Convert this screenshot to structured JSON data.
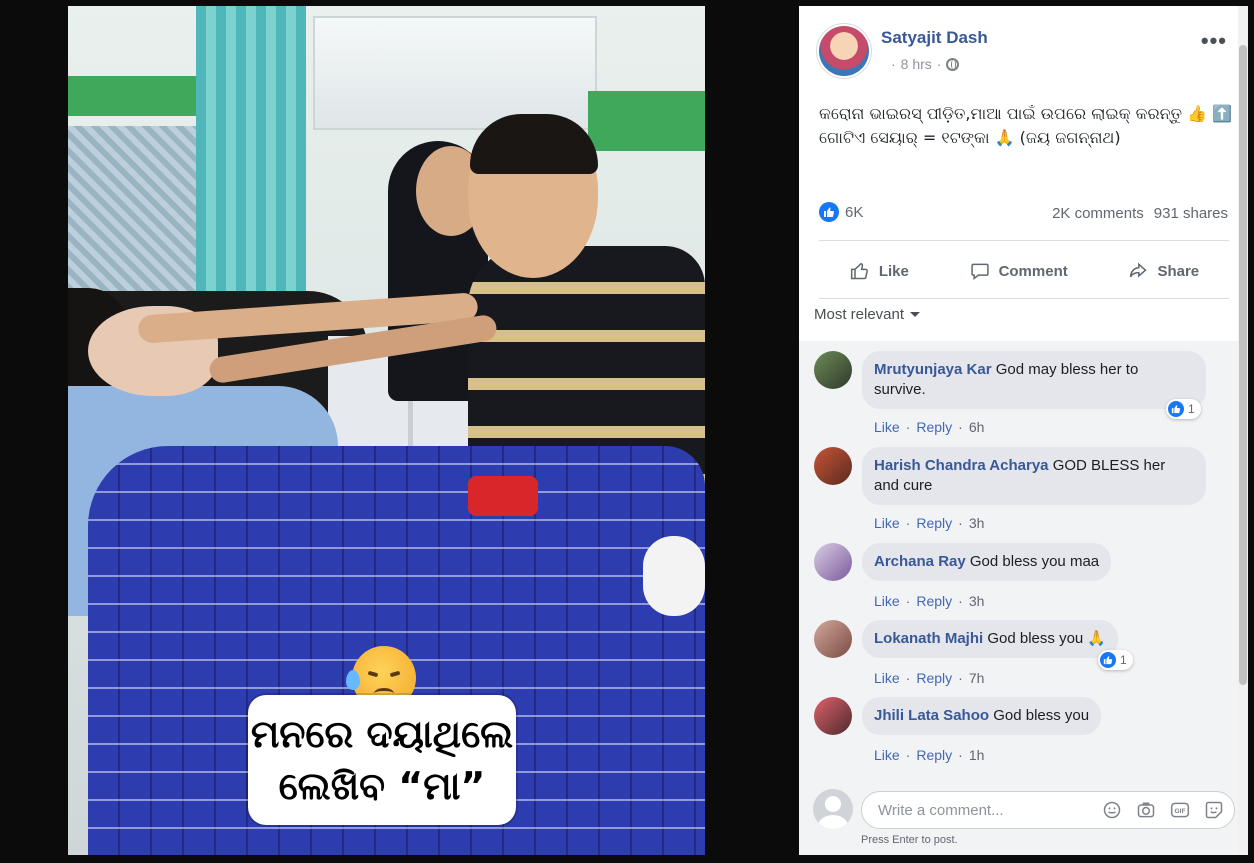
{
  "post": {
    "author": "Satyajit Dash",
    "time": "8 hrs",
    "dots": "·",
    "more": "•••",
    "text_line1": "କରୋନା ଭାଇରସ୍ ପୀଡ଼ିତ,ମାଆ ପାଇଁ ଉପରେ ଲାଇକ୍ କରନ୍ତୁ 👍 ⬆️",
    "text_line2": "ଗୋଟିଏ ସେୟାର୍ = ୧ଟଙ୍କା 🙏 (ଜୟ ଜଗନ୍ନାଥ)",
    "reaction_count": "6K",
    "comments_count": "2K comments",
    "shares_count": "931 shares"
  },
  "photo_caption": {
    "line1": "ମନରେ ଦୟାଥିଲେ",
    "line2": "ଲେଖିବ “ମା”"
  },
  "actions": {
    "like": "Like",
    "comment": "Comment",
    "share": "Share"
  },
  "sort": {
    "label": "Most relevant"
  },
  "comments": [
    {
      "name": "Mrutyunjaya Kar",
      "text": "God may bless her to survive.",
      "like": "Like",
      "reply": "Reply",
      "time": "6h",
      "reacts": "1"
    },
    {
      "name": "Harish Chandra Acharya",
      "text": "GOD BLESS her and cure",
      "like": "Like",
      "reply": "Reply",
      "time": "3h"
    },
    {
      "name": "Archana Ray",
      "text": "God bless you maa",
      "like": "Like",
      "reply": "Reply",
      "time": "3h"
    },
    {
      "name": "Lokanath Majhi",
      "text": "God bless you 🙏",
      "like": "Like",
      "reply": "Reply",
      "time": "7h",
      "reacts": "1"
    },
    {
      "name": "Jhili Lata Sahoo",
      "text": "God bless you",
      "like": "Like",
      "reply": "Reply",
      "time": "1h"
    }
  ],
  "composer": {
    "placeholder": "Write a comment...",
    "hint": "Press Enter to post."
  },
  "icons": [
    "like-icon",
    "comment-icon",
    "share-icon",
    "globe-icon",
    "emoji-icon",
    "camera-icon",
    "gif-icon",
    "sticker-icon"
  ],
  "colors": {
    "link": "#385898",
    "accent": "#1877f2",
    "text": "#1d2129",
    "muted": "#606770"
  }
}
